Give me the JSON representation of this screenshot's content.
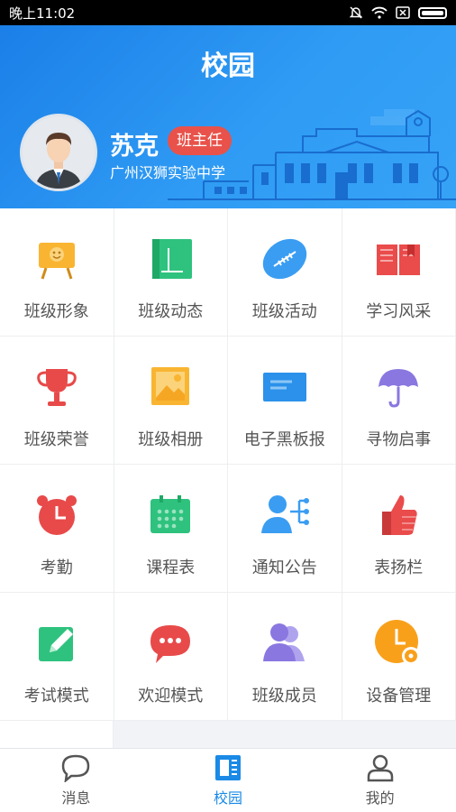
{
  "status_bar": {
    "time": "晚上11:02"
  },
  "header": {
    "title": "校园",
    "user_name": "苏克",
    "role": "班主任",
    "school": "广州汉狮实验中学"
  },
  "grid_items": [
    {
      "label": "班级形象",
      "icon": "easel-smiley-icon",
      "color": "#f9b531"
    },
    {
      "label": "班级动态",
      "icon": "green-book-icon",
      "color": "#2ec27e"
    },
    {
      "label": "班级活动",
      "icon": "rugby-ball-icon",
      "color": "#3a9df2"
    },
    {
      "label": "学习风采",
      "icon": "open-book-icon",
      "color": "#ea4b4b"
    },
    {
      "label": "班级荣誉",
      "icon": "trophy-icon",
      "color": "#e84a4a"
    },
    {
      "label": "班级相册",
      "icon": "photo-album-icon",
      "color": "#f9b531"
    },
    {
      "label": "电子黑板报",
      "icon": "blackboard-icon",
      "color": "#2b91ea"
    },
    {
      "label": "寻物启事",
      "icon": "umbrella-icon",
      "color": "#8a77e0"
    },
    {
      "label": "考勤",
      "icon": "alarm-clock-icon",
      "color": "#e84a4a"
    },
    {
      "label": "课程表",
      "icon": "calendar-icon",
      "color": "#2ec27e"
    },
    {
      "label": "通知公告",
      "icon": "announcement-icon",
      "color": "#3a9df2"
    },
    {
      "label": "表扬栏",
      "icon": "thumbs-up-icon",
      "color": "#ea4b4b"
    },
    {
      "label": "考试模式",
      "icon": "exam-pencil-icon",
      "color": "#2ec27e"
    },
    {
      "label": "欢迎模式",
      "icon": "chat-bubble-icon",
      "color": "#e84a4a"
    },
    {
      "label": "班级成员",
      "icon": "members-icon",
      "color": "#8a77e0"
    },
    {
      "label": "设备管理",
      "icon": "clock-gear-icon",
      "color": "#f9a01b"
    }
  ],
  "tabs": [
    {
      "label": "消息",
      "icon": "message-icon"
    },
    {
      "label": "校园",
      "icon": "campus-icon",
      "active": true
    },
    {
      "label": "我的",
      "icon": "profile-icon"
    }
  ],
  "colors": {
    "accent": "#1a8ae6",
    "header_start": "#1b7fe8",
    "badge": "#e8524a"
  }
}
